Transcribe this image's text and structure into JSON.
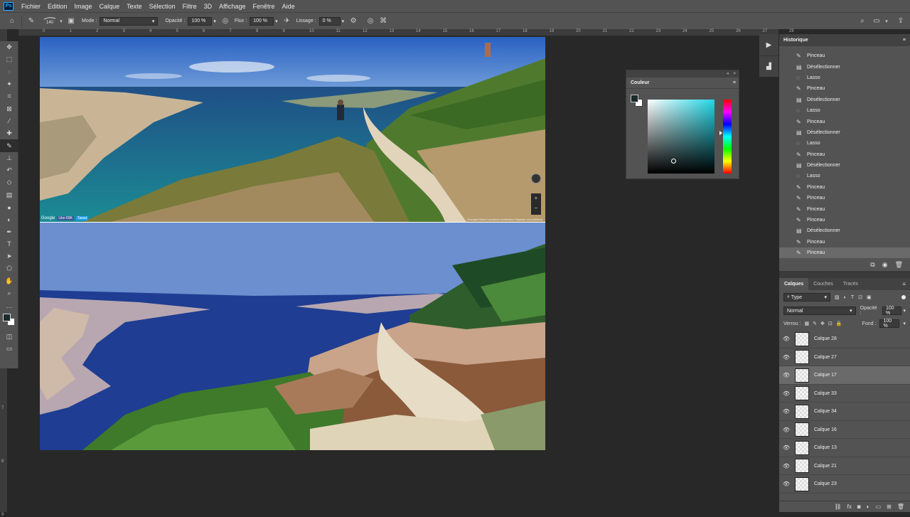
{
  "app": {
    "logo": "Ps"
  },
  "menu": [
    "Fichier",
    "Edition",
    "Image",
    "Calque",
    "Texte",
    "Sélection",
    "Filtre",
    "3D",
    "Affichage",
    "Fenêtre",
    "Aide"
  ],
  "options": {
    "brush_size": "140",
    "mode_label": "Mode :",
    "mode_value": "Normal",
    "opacity_label": "Opacité :",
    "opacity_value": "100 %",
    "flow_label": "Flux :",
    "flow_value": "100 %",
    "smoothing_label": "Lissage :",
    "smoothing_value": "0 %"
  },
  "ruler_top": [
    "0",
    "1",
    "2",
    "3",
    "4",
    "5",
    "6",
    "7",
    "8",
    "9",
    "10",
    "11",
    "12",
    "13",
    "14",
    "15",
    "16",
    "17",
    "18",
    "19",
    "20",
    "21",
    "22",
    "23",
    "24",
    "25",
    "26",
    "27",
    "28"
  ],
  "ruler_left": [
    "1",
    "2",
    "3",
    "4",
    "5",
    "6",
    "7",
    "8",
    "9"
  ],
  "tools": [
    "move-tool",
    "marquee-tool",
    "lasso-tool",
    "magic-wand-tool",
    "crop-tool",
    "frame-tool",
    "eyedropper-tool",
    "healing-tool",
    "brush-tool",
    "stamp-tool",
    "history-brush-tool",
    "eraser-tool",
    "gradient-tool",
    "blur-tool",
    "dodge-tool",
    "pen-tool",
    "type-tool",
    "path-select-tool",
    "shape-tool",
    "hand-tool",
    "zoom-tool",
    "more-tools"
  ],
  "photo_overlay": {
    "google": "Google",
    "like": "Like 69K",
    "tweet": "Tweet",
    "footer_right": "©Images Bess    Conditions d'utilisation    Signaler un problème"
  },
  "color_panel": {
    "title": "Couleur",
    "fg": "#1c2a2a",
    "bg": "#ffffff",
    "hue": "#22d8e8"
  },
  "history": {
    "title": "Historique",
    "items": [
      {
        "label": "Pinceau",
        "icon": "brush"
      },
      {
        "label": "Désélectionner",
        "icon": "doc"
      },
      {
        "label": "Lasso",
        "icon": "lasso"
      },
      {
        "label": "Pinceau",
        "icon": "brush"
      },
      {
        "label": "Désélectionner",
        "icon": "doc"
      },
      {
        "label": "Lasso",
        "icon": "lasso"
      },
      {
        "label": "Pinceau",
        "icon": "brush"
      },
      {
        "label": "Désélectionner",
        "icon": "doc"
      },
      {
        "label": "Lasso",
        "icon": "lasso"
      },
      {
        "label": "Pinceau",
        "icon": "brush"
      },
      {
        "label": "Désélectionner",
        "icon": "doc"
      },
      {
        "label": "Lasso",
        "icon": "lasso"
      },
      {
        "label": "Pinceau",
        "icon": "brush"
      },
      {
        "label": "Pinceau",
        "icon": "brush"
      },
      {
        "label": "Pinceau",
        "icon": "brush"
      },
      {
        "label": "Pinceau",
        "icon": "brush"
      },
      {
        "label": "Désélectionner",
        "icon": "doc"
      },
      {
        "label": "Pinceau",
        "icon": "brush"
      },
      {
        "label": "Pinceau",
        "icon": "brush"
      }
    ]
  },
  "layers_panel": {
    "tabs": [
      "Calques",
      "Couches",
      "Tracés"
    ],
    "filter": "Type",
    "blend": "Normal",
    "opacity_label": "Opacité :",
    "opacity_value": "100 %",
    "lock_label": "Verrou :",
    "fill_label": "Fond :",
    "fill_value": "100 %",
    "layers": [
      "Calque 28",
      "Calque 27",
      "Calque 17",
      "Calque 33",
      "Calque 34",
      "Calque 16",
      "Calque 13",
      "Calque 21",
      "Calque 23"
    ],
    "selected_index": 2
  }
}
